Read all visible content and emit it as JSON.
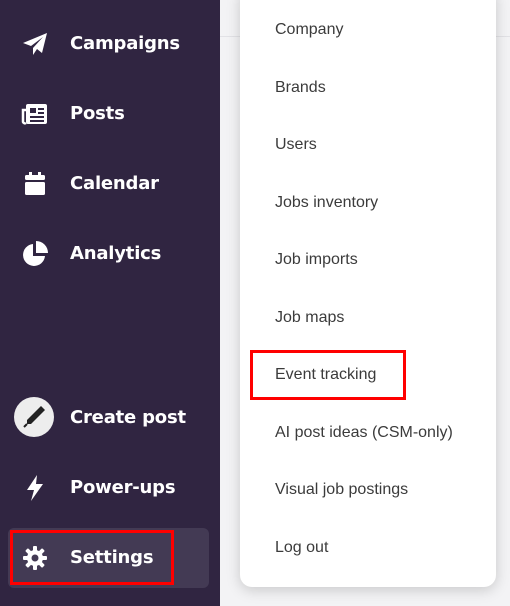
{
  "sidebar": {
    "items": [
      {
        "label": "Campaigns",
        "icon": "paper-plane-icon"
      },
      {
        "label": "Posts",
        "icon": "newspaper-icon"
      },
      {
        "label": "Calendar",
        "icon": "calendar-icon"
      },
      {
        "label": "Analytics",
        "icon": "pie-chart-icon"
      }
    ],
    "bottom_items": [
      {
        "label": "Create post",
        "icon": "pen-icon"
      },
      {
        "label": "Power-ups",
        "icon": "lightning-icon"
      },
      {
        "label": "Settings",
        "icon": "gear-icon",
        "active": true
      }
    ]
  },
  "settings_menu": {
    "items": [
      "Company",
      "Brands",
      "Users",
      "Jobs inventory",
      "Job imports",
      "Job maps",
      "Event tracking",
      "AI post ideas (CSM-only)",
      "Visual job postings",
      "Log out"
    ],
    "highlighted_item": "Event tracking"
  },
  "colors": {
    "sidebar_bg": "#302541",
    "active_item_bg": "#433a54",
    "highlight": "#ff0000",
    "menu_text": "#3b3b3b"
  }
}
